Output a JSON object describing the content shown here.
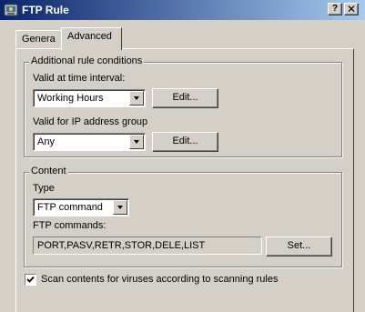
{
  "window": {
    "title": "FTP Rule",
    "help_glyph": "?",
    "close_glyph": "✕"
  },
  "tabs": [
    {
      "label": "Genera"
    },
    {
      "label": "Advanced"
    }
  ],
  "conditions": {
    "group_label": "Additional rule conditions",
    "time_label": "Valid at time interval:",
    "time_value": "Working Hours",
    "time_edit": "Edit...",
    "ip_label": "Valid for IP address group",
    "ip_value": "Any",
    "ip_edit": "Edit..."
  },
  "content": {
    "group_label": "Content",
    "type_label": "Type",
    "type_value": "FTP command",
    "commands_label": "FTP commands:",
    "commands_value": "PORT,PASV,RETR,STOR,DELE,LIST",
    "set_button": "Set..."
  },
  "scan": {
    "label": "Scan contents for viruses according to scanning rules",
    "checked": true
  }
}
